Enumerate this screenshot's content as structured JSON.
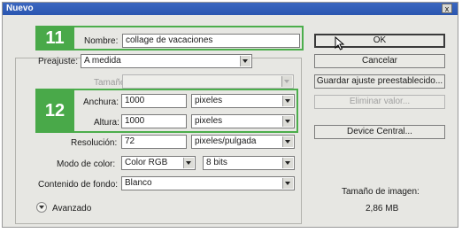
{
  "window": {
    "title": "Nuevo",
    "close_glyph": "x"
  },
  "badges": {
    "step1": "11",
    "step2": "12"
  },
  "form": {
    "nombre": {
      "label": "Nombre:",
      "value": "collage de vacaciones"
    },
    "preajuste": {
      "label": "Preajuste:",
      "value": "A medida"
    },
    "tamano": {
      "label": "Tamaño:",
      "value": ""
    },
    "anchura": {
      "label": "Anchura:",
      "value": "1000",
      "unit": "pixeles"
    },
    "altura": {
      "label": "Altura:",
      "value": "1000",
      "unit": "pixeles"
    },
    "resolucion": {
      "label": "Resolución:",
      "value": "72",
      "unit": "pixeles/pulgada"
    },
    "modo_color": {
      "label": "Modo de color:",
      "value": "Color RGB",
      "bits": "8 bits"
    },
    "contenido_fondo": {
      "label": "Contenido de fondo:",
      "value": "Blanco"
    },
    "avanzado": {
      "label": "Avanzado",
      "icon": "chevron-down-icon"
    }
  },
  "buttons": {
    "ok": "OK",
    "cancel": "Cancelar",
    "save_preset": "Guardar ajuste preestablecido...",
    "delete_preset": "Eliminar valor...",
    "device_central": "Device Central..."
  },
  "image_size": {
    "label": "Tamaño de imagen:",
    "value": "2,86 MB"
  },
  "colors": {
    "highlight_green": "#4cae4c",
    "titlebar_blue": "#2a56b0"
  }
}
